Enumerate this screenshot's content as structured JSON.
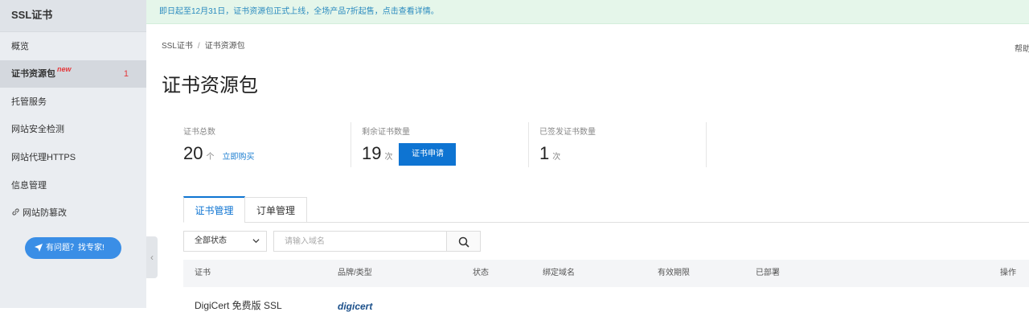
{
  "sidebar": {
    "title": "SSL证书",
    "items": [
      {
        "label": "概览"
      },
      {
        "label": "证书资源包",
        "badge": "new",
        "count": "1"
      },
      {
        "label": "托管服务"
      },
      {
        "label": "网站安全检测"
      },
      {
        "label": "网站代理HTTPS"
      },
      {
        "label": "信息管理"
      },
      {
        "label": "网站防篡改"
      }
    ],
    "help_button": "有问题？找专家!"
  },
  "banner": "即日起至12月31日，证书资源包正式上线，全场产品7折起售，点击查看详情。",
  "breadcrumb": {
    "root": "SSL证书",
    "sep": "/",
    "current": "证书资源包"
  },
  "help_top": "帮助",
  "page_title": "证书资源包",
  "stats": [
    {
      "label": "证书总数",
      "value": "20",
      "unit": "个",
      "link": "立即购买"
    },
    {
      "label": "剩余证书数量",
      "value": "19",
      "unit": "次",
      "button": "证书申请"
    },
    {
      "label": "已签发证书数量",
      "value": "1",
      "unit": "次"
    }
  ],
  "tabs": [
    {
      "label": "证书管理",
      "active": true
    },
    {
      "label": "订单管理",
      "active": false
    }
  ],
  "filter": {
    "status_selected": "全部状态",
    "search_placeholder": "请输入域名"
  },
  "table": {
    "columns": [
      "证书",
      "品牌/类型",
      "状态",
      "绑定域名",
      "有效期限",
      "已部署",
      "操作"
    ],
    "rows": [
      {
        "cert": "DigiCert 免费版 SSL",
        "brand": "digicert"
      }
    ]
  },
  "colors": {
    "accent": "#0e74d2",
    "new_badge": "#e4393c",
    "banner_bg": "#e5f6ea"
  }
}
